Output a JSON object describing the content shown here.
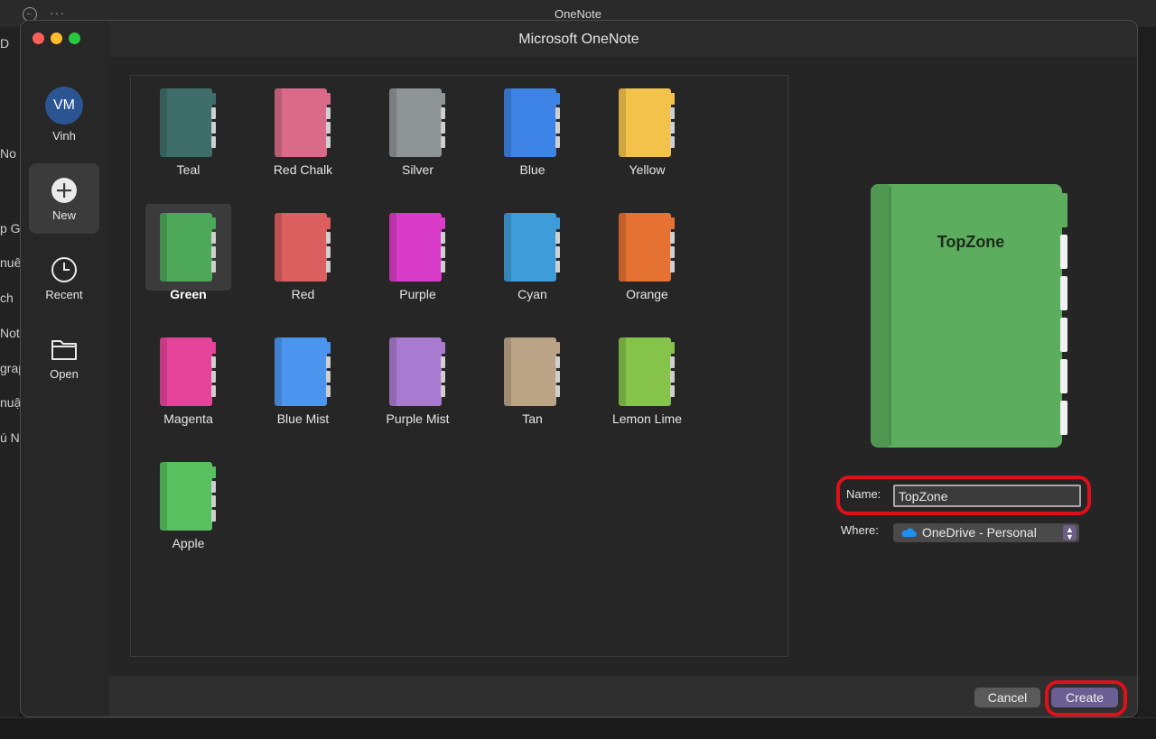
{
  "background_app": {
    "title": "OneNote",
    "sidebar_fragments": [
      "D",
      "No",
      "p G",
      "nuê",
      "ch",
      "Not",
      "grap",
      "nuậ",
      "ú N"
    ]
  },
  "dialog": {
    "title": "Microsoft OneNote",
    "user": {
      "initials": "VM",
      "name": "Vinh"
    },
    "nav": [
      {
        "label": "New",
        "icon": "plus-circle-icon",
        "active": true
      },
      {
        "label": "Recent",
        "icon": "clock-icon",
        "active": false
      },
      {
        "label": "Open",
        "icon": "folder-icon",
        "active": false
      }
    ],
    "notebooks": [
      {
        "label": "Teal",
        "color": "#3f6e6a"
      },
      {
        "label": "Red Chalk",
        "color": "#d96a8a"
      },
      {
        "label": "Silver",
        "color": "#8e9396"
      },
      {
        "label": "Blue",
        "color": "#3d84e6"
      },
      {
        "label": "Yellow",
        "color": "#f2c24a"
      },
      {
        "label": "Green",
        "color": "#4ea85a",
        "selected": true
      },
      {
        "label": "Red",
        "color": "#dc5f60"
      },
      {
        "label": "Purple",
        "color": "#d93cc8"
      },
      {
        "label": "Cyan",
        "color": "#3e9cd8"
      },
      {
        "label": "Orange",
        "color": "#e57233"
      },
      {
        "label": "Magenta",
        "color": "#e6449b"
      },
      {
        "label": "Blue Mist",
        "color": "#4c95ee"
      },
      {
        "label": "Purple Mist",
        "color": "#a87bd0"
      },
      {
        "label": "Tan",
        "color": "#bba386"
      },
      {
        "label": "Lemon Lime",
        "color": "#86c34a"
      },
      {
        "label": "Apple",
        "color": "#58c05e"
      }
    ],
    "preview": {
      "title": "TopZone",
      "color": "#5cad5e"
    },
    "form": {
      "name_label": "Name:",
      "name_value": "TopZone",
      "where_label": "Where:",
      "where_value": "OneDrive - Personal"
    },
    "buttons": {
      "cancel": "Cancel",
      "create": "Create"
    },
    "highlight_color": "#e0101a"
  }
}
